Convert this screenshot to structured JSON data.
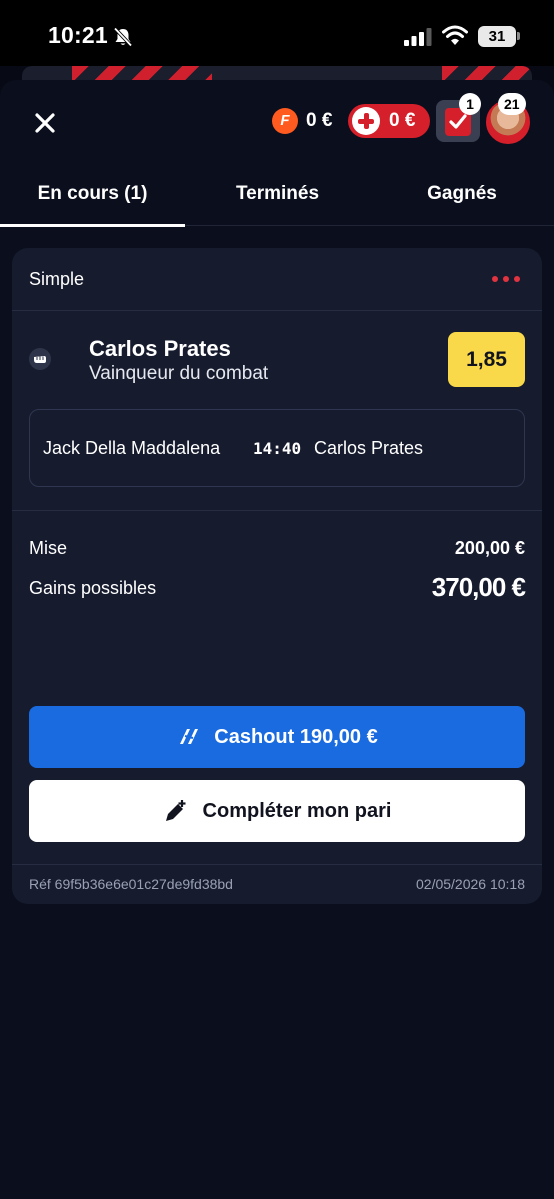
{
  "status_bar": {
    "time": "10:21",
    "battery": "31"
  },
  "header": {
    "freebet_logo": "F",
    "freebet_amount": "0 €",
    "boost_amount": "0 €",
    "betslip_count": "1",
    "profile_badge": "21"
  },
  "tabs": [
    {
      "label": "En cours (1)",
      "active": true
    },
    {
      "label": "Terminés",
      "active": false
    },
    {
      "label": "Gagnés",
      "active": false
    }
  ],
  "bet": {
    "type": "Simple",
    "selection": "Carlos Prates",
    "market": "Vainqueur du combat",
    "odds": "1,85",
    "event": {
      "home": "Jack Della Maddalena",
      "time": "14:40",
      "away": "Carlos Prates"
    },
    "stake_label": "Mise",
    "stake_value": "200,00 €",
    "winnings_label": "Gains possibles",
    "winnings_value": "370,00 €",
    "cashout_label": "Cashout 190,00 €",
    "complete_label": "Compléter mon pari",
    "reference": "Réf 69f5b36e6e01c27de9fd38bd",
    "date": "02/05/2026 10:18"
  },
  "colors": {
    "background": "#070915",
    "card": "#161b2e",
    "accent_red": "#d51f2a",
    "odds_yellow": "#f9d84a",
    "cashout_blue": "#1a6be0"
  }
}
